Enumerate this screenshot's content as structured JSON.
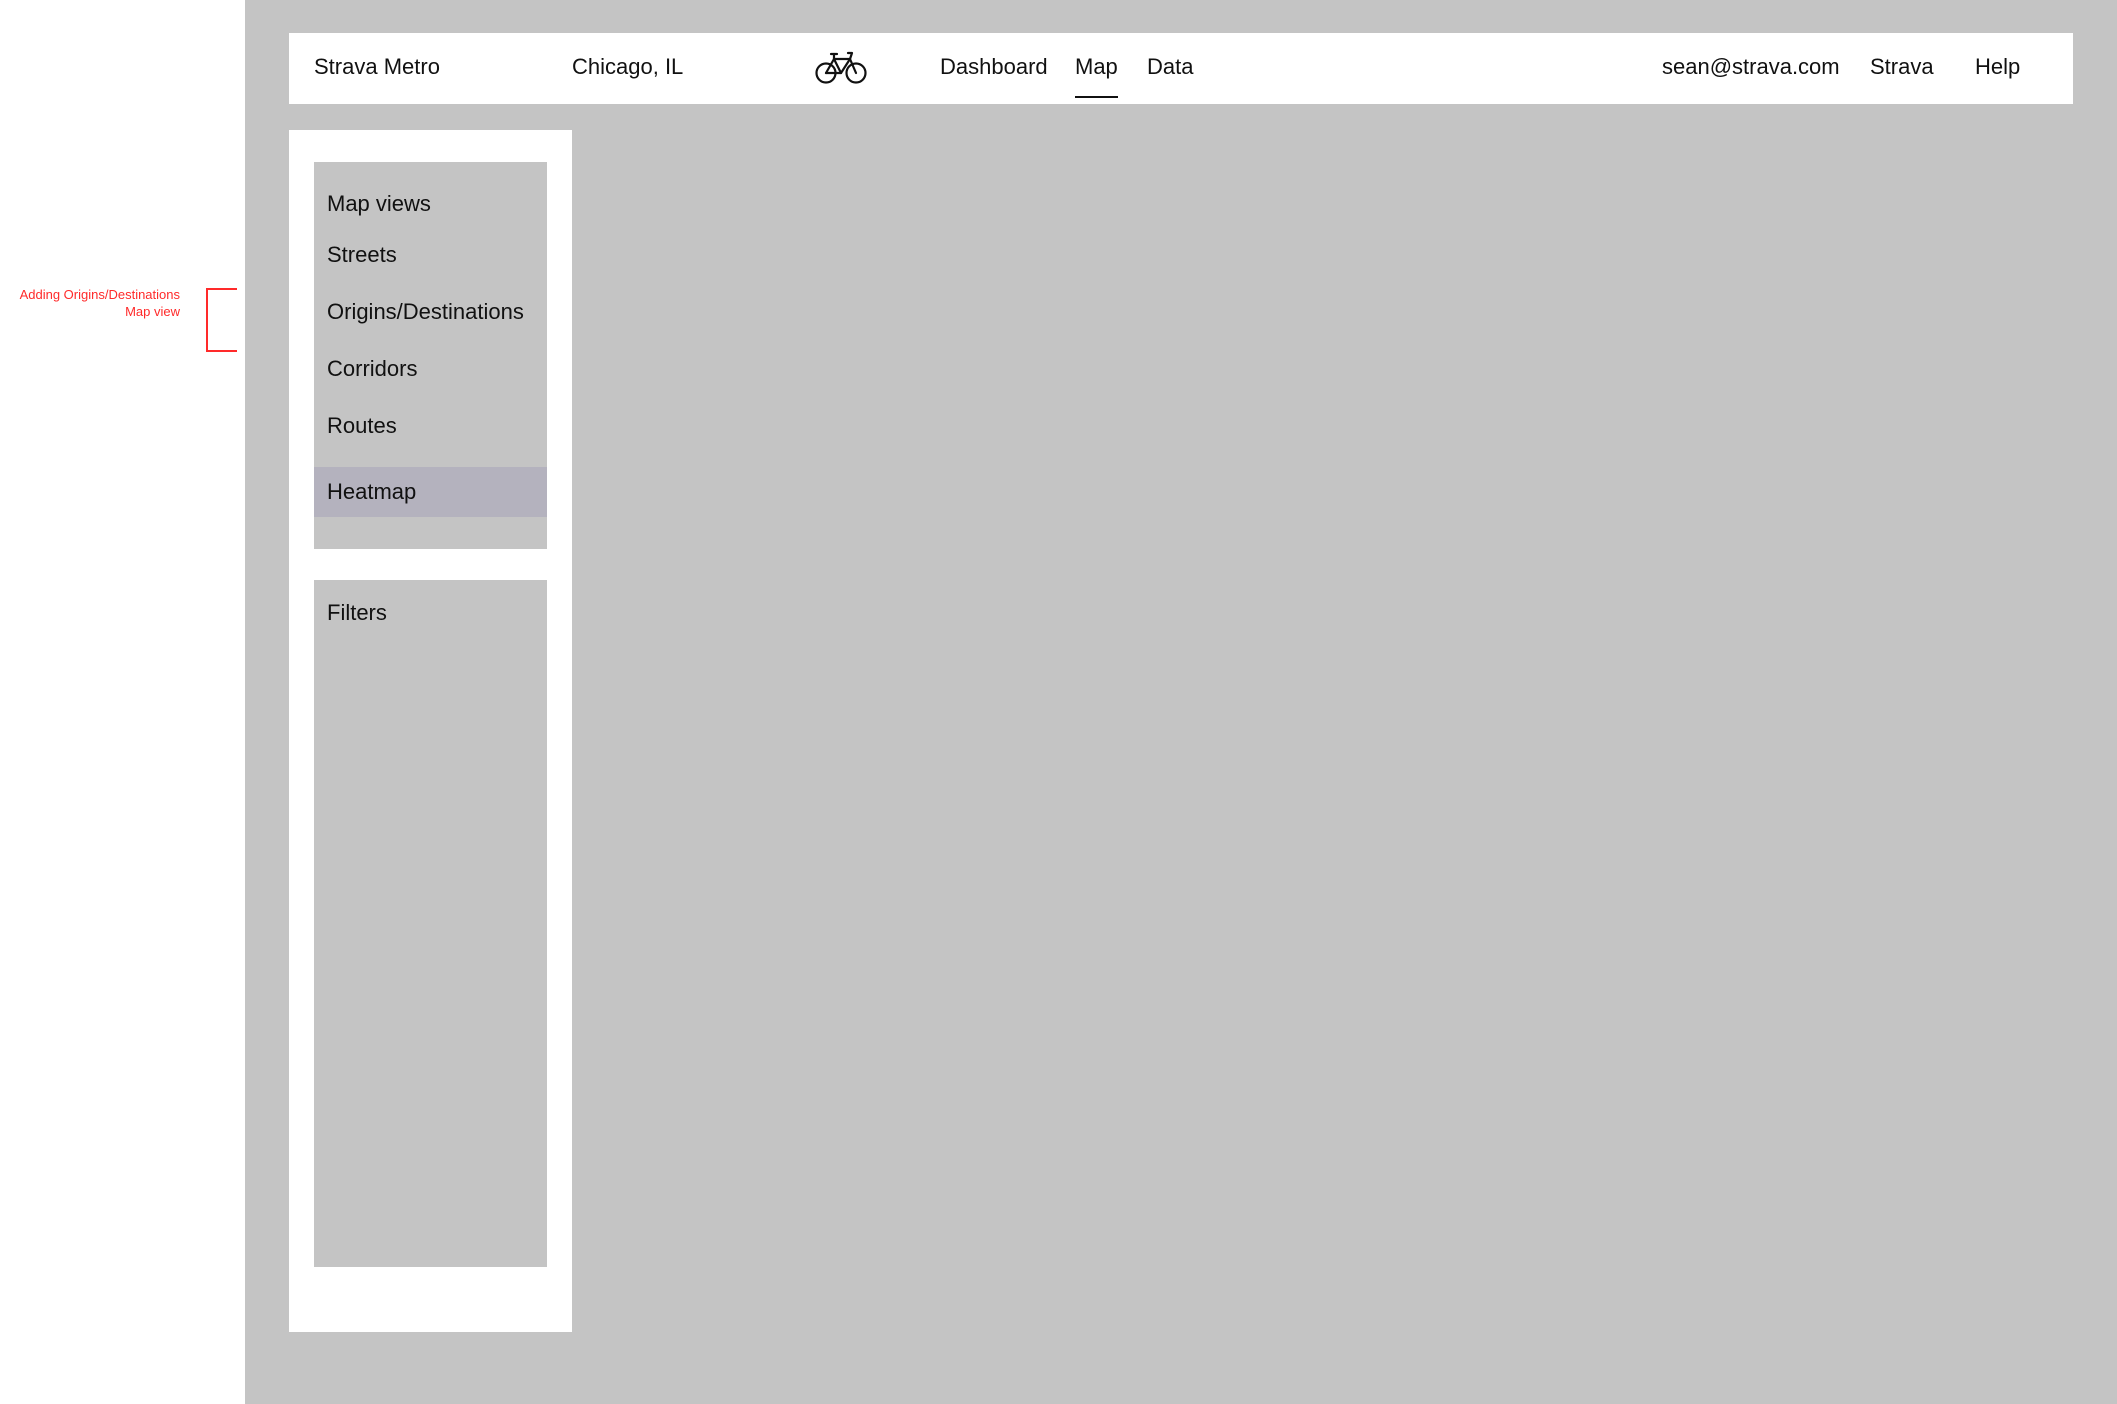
{
  "annotation": {
    "lines": [
      "Adding Origins/Destinations",
      "Map view"
    ],
    "color": "#ff2a2a"
  },
  "header": {
    "brand": "Strava Metro",
    "location": "Chicago, IL",
    "logo_icon": "bicycle-icon",
    "tabs": [
      {
        "label": "Dashboard",
        "active": false
      },
      {
        "label": "Map",
        "active": true
      },
      {
        "label": "Data",
        "active": false
      }
    ],
    "user_email": "sean@strava.com",
    "links": [
      {
        "label": "Strava"
      },
      {
        "label": "Help"
      }
    ]
  },
  "sidebar": {
    "map_views": {
      "title": "Map views",
      "items": [
        {
          "label": "Streets",
          "selected": false
        },
        {
          "label": "Origins/Destinations",
          "selected": false
        },
        {
          "label": "Corridors",
          "selected": false
        },
        {
          "label": "Routes",
          "selected": false
        },
        {
          "label": "Heatmap",
          "selected": true
        }
      ],
      "selected_color": "#b4b2be"
    },
    "filters": {
      "title": "Filters"
    }
  },
  "colors": {
    "canvas": "#c4c4c4",
    "panel": "#c4c4c4",
    "surface": "#ffffff"
  }
}
